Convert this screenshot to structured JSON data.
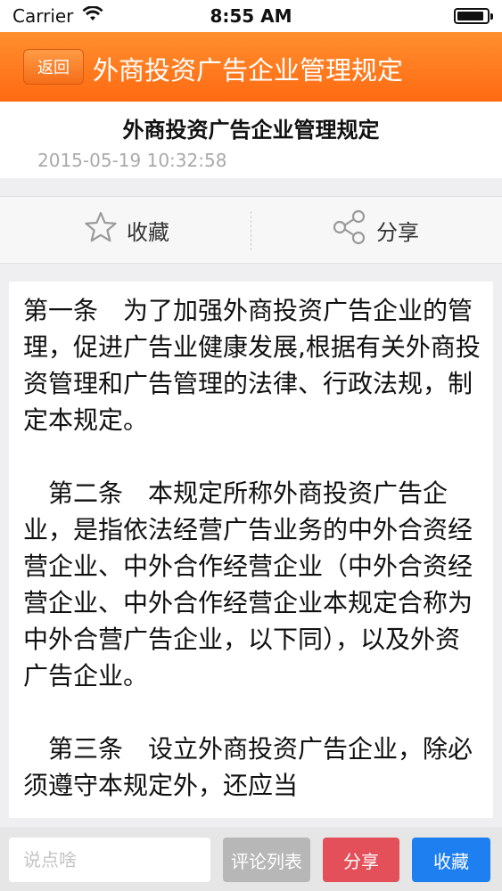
{
  "status_bar": {
    "carrier": "Carrier",
    "time": "8:55 AM",
    "battery_level": 0.9
  },
  "nav": {
    "back_label": "返回",
    "title": "外商投资广告企业管理规定",
    "color": "#ff7a1f"
  },
  "article": {
    "title": "外商投资广告企业管理规定",
    "date": "2015-05-19 10:32:58",
    "paragraphs": [
      "第一条　为了加强外商投资广告企业的管理，促进广告业健康发展,根据有关外商投资管理和广告管理的法律、行政法规，制定本规定。",
      "第二条　本规定所称外商投资广告企业，是指依法经营广告业务的中外合资经营企业、中外合作经营企业（中外合资经营企业、中外合作经营企业本规定合称为中外合营广告企业，以下同），以及外资广告企业。",
      "第三条　设立外商投资广告企业，除必须遵守本规定外，还应当"
    ]
  },
  "actions": {
    "favorite_label": "收藏",
    "favorite_icon": "star-outline-icon",
    "share_label": "分享",
    "share_icon": "share-nodes-icon"
  },
  "bottom_bar": {
    "comment_placeholder": "说点啥",
    "comment_list_label": "评论列表",
    "share_label": "分享",
    "favorite_label": "收藏",
    "colors": {
      "comment_list": "#b7b7b7",
      "share": "#e4505a",
      "favorite": "#1d7ff0"
    }
  }
}
